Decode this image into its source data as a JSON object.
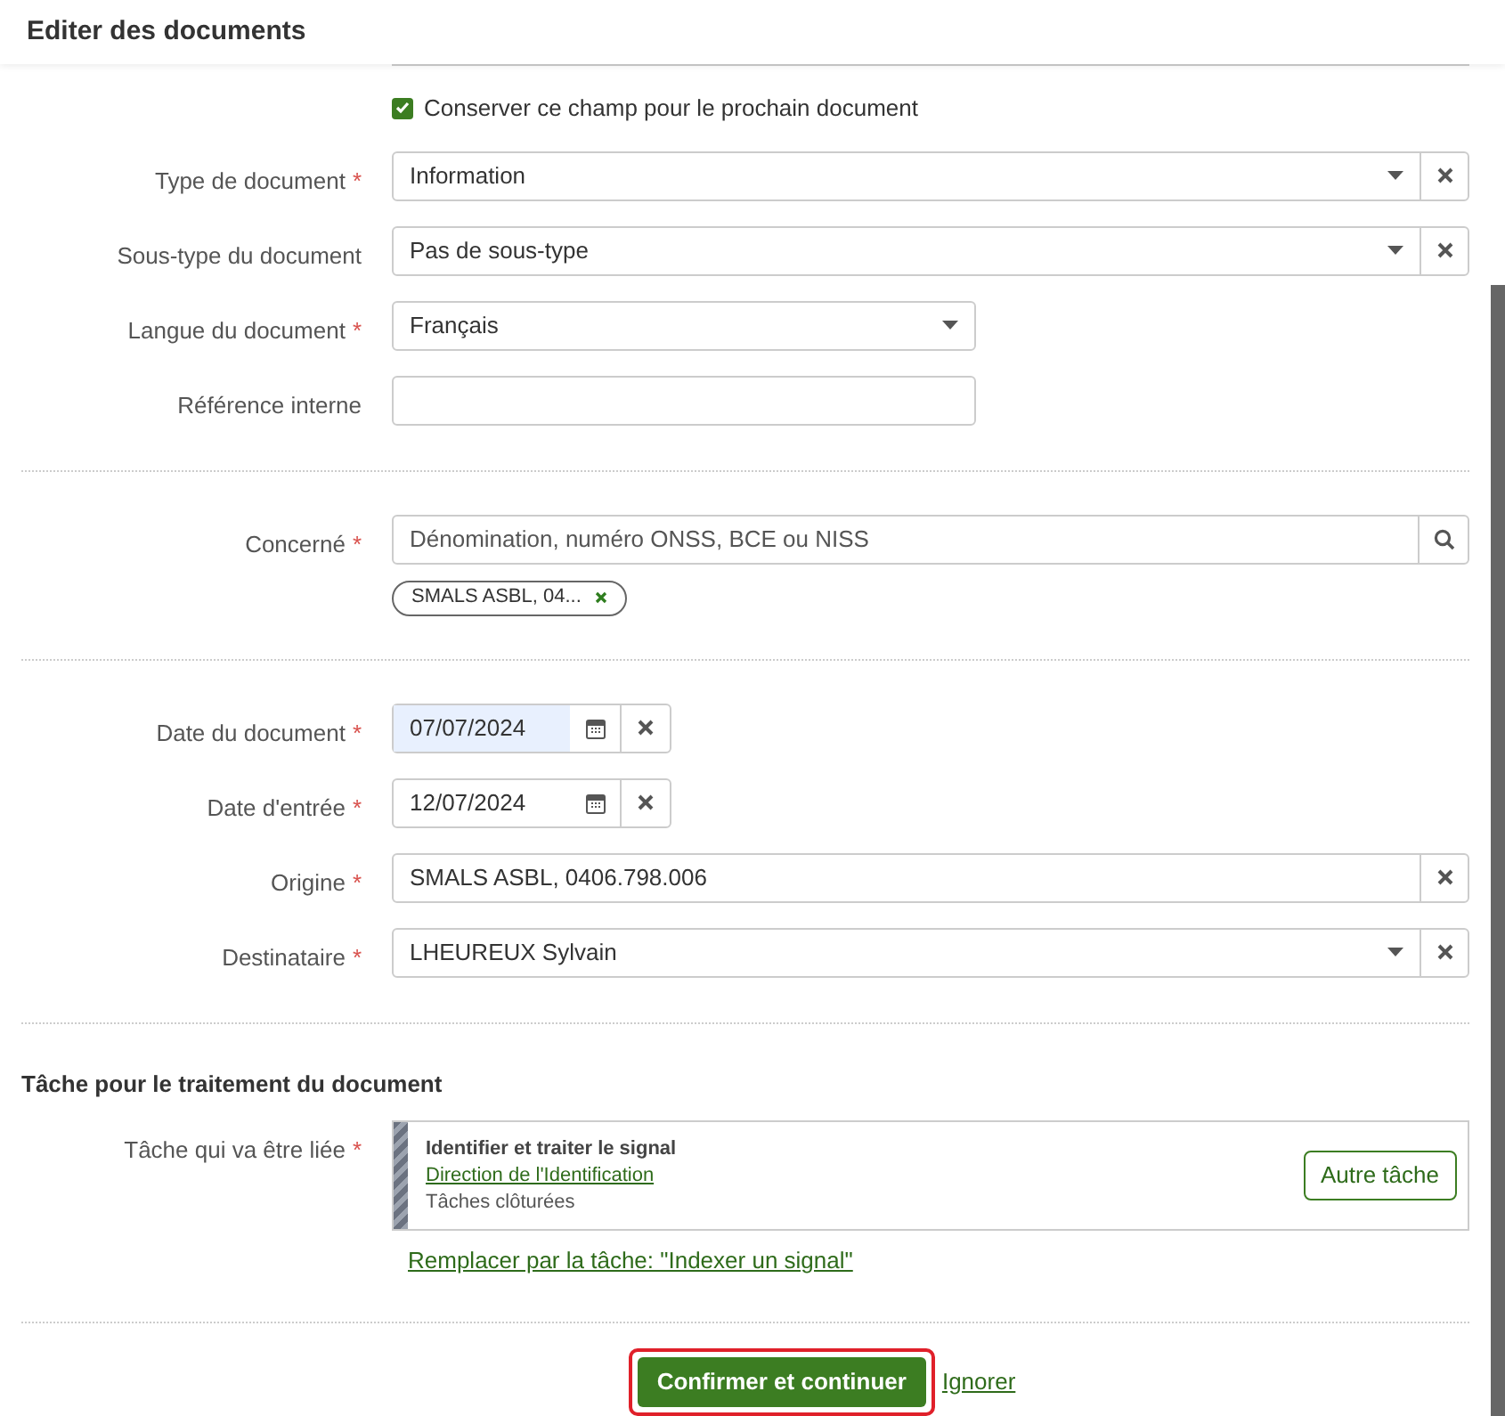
{
  "window": {
    "title": "Editer des documents"
  },
  "keep_field": {
    "label": "Conserver ce champ pour le prochain document",
    "checked": true
  },
  "sections": [
    {
      "fields": [
        {
          "label": "Type de document",
          "required_mark": "*",
          "kind": "select",
          "wide": true,
          "value": "Information",
          "caret": true,
          "clearable": true
        },
        {
          "label": "Sous-type du document",
          "kind": "select",
          "wide": true,
          "value": "Pas de sous-type",
          "caret": true,
          "clearable": true
        },
        {
          "label": "Langue du document",
          "required_mark": "*",
          "kind": "select",
          "wide": false,
          "value": "Français",
          "caret": true,
          "clearable": false
        },
        {
          "label": "Référence interne",
          "kind": "text",
          "wide": false
        }
      ]
    },
    {
      "fields": [
        {
          "label": "Concerné",
          "required_mark": "*",
          "kind": "search",
          "wide": true,
          "placeholder": "Dénomination, numéro ONSS, BCE ou NISS",
          "tags": [
            {
              "label": "SMALS ASBL, 04..."
            }
          ]
        }
      ]
    },
    {
      "fields": [
        {
          "label": "Date du document",
          "required_mark": "*",
          "kind": "date",
          "value": "07/07/2024",
          "focused": true,
          "clearable": true
        },
        {
          "label": "Date d'entrée",
          "required_mark": "*",
          "kind": "date",
          "value": "12/07/2024",
          "focused": false,
          "clearable": true
        },
        {
          "label": "Origine",
          "required_mark": "*",
          "kind": "select",
          "wide": true,
          "value": "SMALS ASBL, 0406.798.006",
          "caret": false,
          "clearable": true
        },
        {
          "label": "Destinataire",
          "required_mark": "*",
          "kind": "select",
          "wide": true,
          "value": "LHEUREUX Sylvain",
          "caret": true,
          "clearable": true
        }
      ]
    }
  ],
  "task_section": {
    "title": "Tâche pour le traitement du document",
    "label": "Tâche qui va être liée",
    "required_mark": "*",
    "task": {
      "title": "Identifier et traiter le signal",
      "link": "Direction de l'Identification",
      "status": "Tâches clôturées",
      "button": "Autre tâche"
    },
    "replace_link": "Remplacer par la tâche: \"Indexer un signal\""
  },
  "footer": {
    "confirm": "Confirmer et continuer",
    "ignore": "Ignorer"
  }
}
